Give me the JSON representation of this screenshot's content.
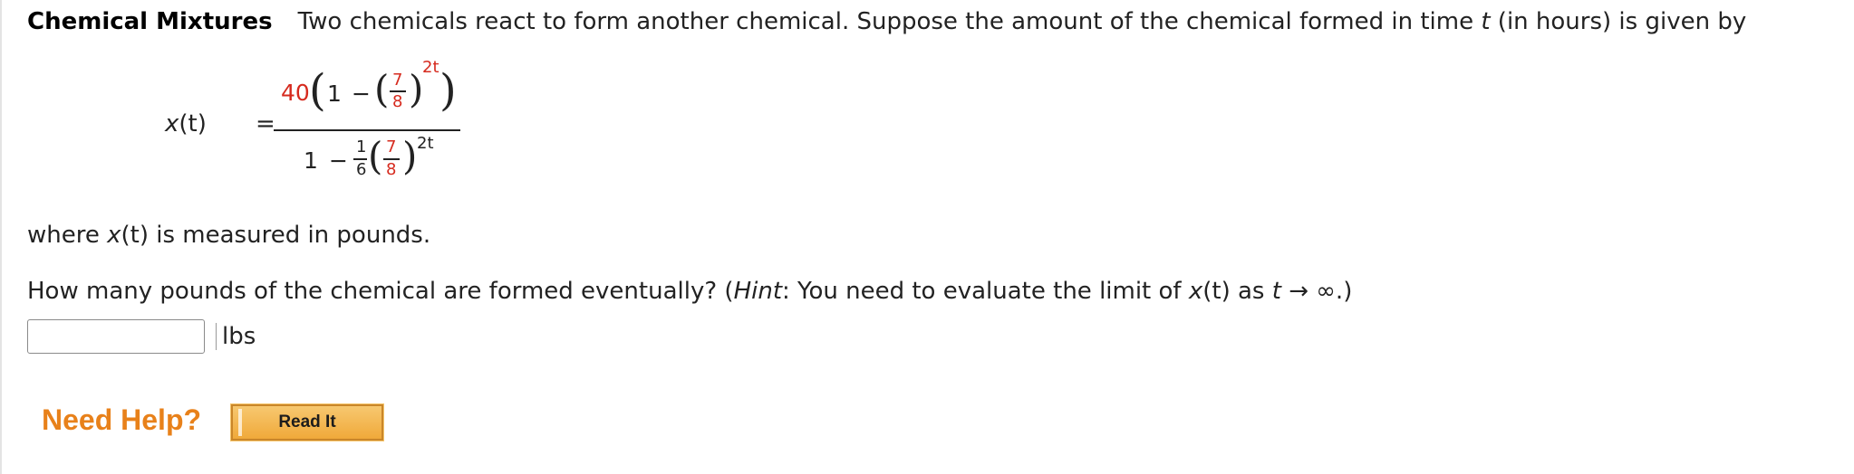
{
  "problem": {
    "title": "Chemical Mixtures",
    "intro_prefix": "Two chemicals react to form another chemical. Suppose the amount of the chemical formed in time ",
    "intro_var": "t",
    "intro_suffix": " (in hours) is given by"
  },
  "formula": {
    "lhs_fn": "x",
    "lhs_arg": "(t)",
    "equals": "=",
    "num_coef": "40",
    "num_one": "1",
    "minus": "−",
    "frac_num": "7",
    "frac_den": "8",
    "exponent_num": "2t",
    "den_one": "1",
    "den_frac_num": "1",
    "den_frac_den": "6",
    "den_inner_num": "7",
    "den_inner_den": "8",
    "exponent_den": "2t"
  },
  "where": {
    "prefix": "where ",
    "fn": "x",
    "arg": "(t)",
    "suffix": " is measured in pounds."
  },
  "question": {
    "text": "How many pounds of the chemical are formed eventually? (",
    "hint_label": "Hint",
    "hint_text": ": You need to evaluate the limit of ",
    "fn": "x",
    "arg": "(t)",
    "as": " as ",
    "var": "t",
    "arrow_inf": " → ∞.)"
  },
  "answer": {
    "value": "",
    "unit": "lbs"
  },
  "help": {
    "label": "Need Help?",
    "button": "Read It"
  },
  "colors": {
    "accent_red": "#d62a1e",
    "help_orange": "#e8811a",
    "button_fill": "#f0a93a"
  }
}
